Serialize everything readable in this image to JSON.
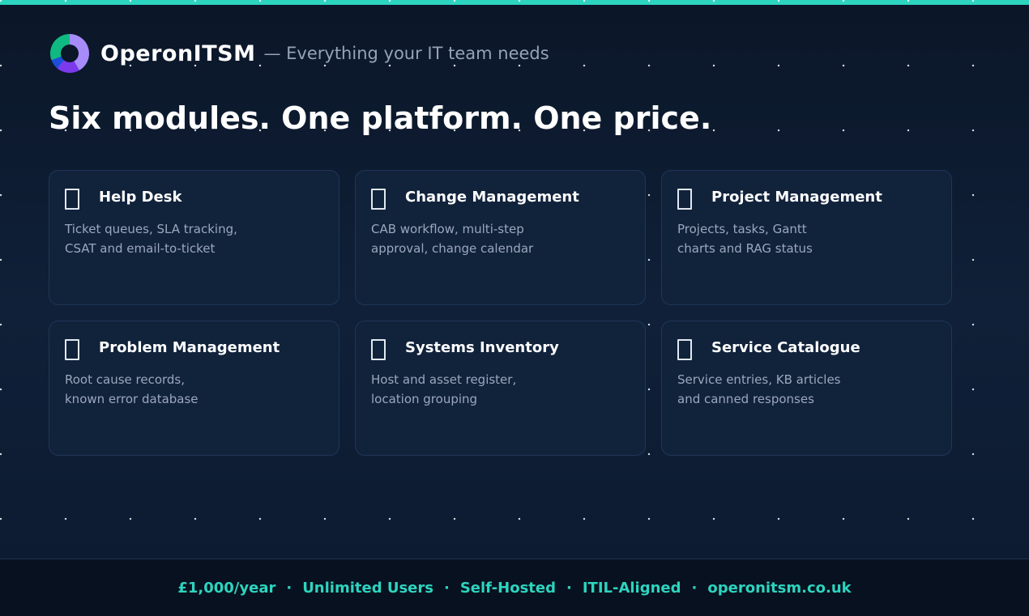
{
  "header": {
    "brand": "OperonITSM",
    "tagline": "— Everything your IT team needs"
  },
  "headline": "Six modules. One platform. One price.",
  "modules": [
    {
      "icon": "help-desk-icon",
      "title": "Help Desk",
      "line1": "Ticket queues, SLA tracking,",
      "line2": "CSAT and email-to-ticket"
    },
    {
      "icon": "change-management-icon",
      "title": "Change Management",
      "line1": "CAB workflow, multi-step",
      "line2": "approval, change calendar"
    },
    {
      "icon": "project-management-icon",
      "title": "Project Management",
      "line1": "Projects, tasks, Gantt",
      "line2": "charts and RAG status"
    },
    {
      "icon": "problem-management-icon",
      "title": "Problem Management",
      "line1": "Root cause records,",
      "line2": "known error database"
    },
    {
      "icon": "systems-inventory-icon",
      "title": "Systems Inventory",
      "line1": "Host and asset register,",
      "line2": "location grouping"
    },
    {
      "icon": "service-catalogue-icon",
      "title": "Service Catalogue",
      "line1": "Service entries, KB articles",
      "line2": "and canned responses"
    }
  ],
  "footer": {
    "price": "£1,000/year",
    "users": "Unlimited Users",
    "hosting": "Self-Hosted",
    "itil": "ITIL-Aligned",
    "website": "operonitsm.co.uk",
    "separator": "·"
  },
  "colors": {
    "accent": "#2dd4bf",
    "background": "#0b1628",
    "card": "#11223b"
  }
}
